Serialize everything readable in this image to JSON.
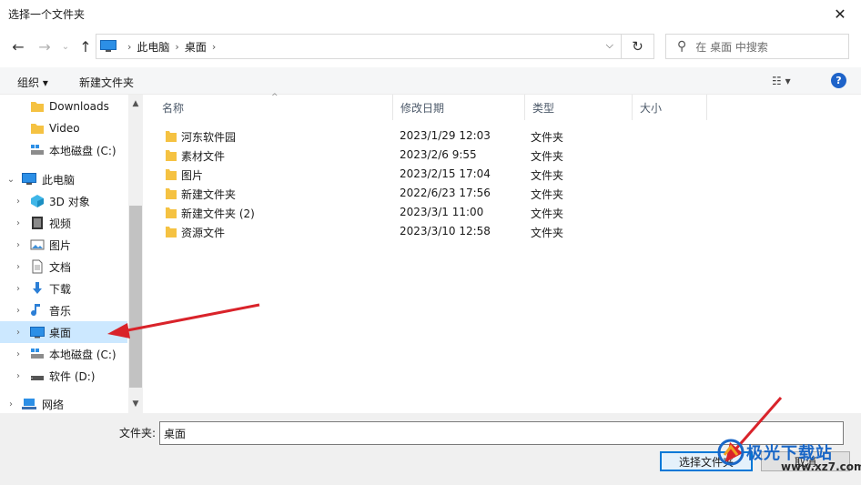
{
  "window": {
    "title": "选择一个文件夹"
  },
  "address": {
    "crumbs": [
      "此电脑",
      "桌面"
    ]
  },
  "search": {
    "placeholder": "在 桌面 中搜索"
  },
  "toolbar": {
    "organize": "组织 ▾",
    "new_folder": "新建文件夹"
  },
  "nav": {
    "items": [
      {
        "label": "Downloads",
        "icon": "folder-icon"
      },
      {
        "label": "Video",
        "icon": "folder-icon"
      },
      {
        "label": "本地磁盘 (C:)",
        "icon": "drive-icon"
      },
      {
        "label": "此电脑",
        "icon": "computer-icon"
      },
      {
        "label": "3D 对象",
        "icon": "cube-icon"
      },
      {
        "label": "视频",
        "icon": "video-icon"
      },
      {
        "label": "图片",
        "icon": "picture-icon"
      },
      {
        "label": "文档",
        "icon": "document-icon"
      },
      {
        "label": "下载",
        "icon": "download-icon"
      },
      {
        "label": "音乐",
        "icon": "music-icon"
      },
      {
        "label": "桌面",
        "icon": "desktop-icon",
        "selected": true
      },
      {
        "label": "本地磁盘 (C:)",
        "icon": "drive-icon"
      },
      {
        "label": "软件 (D:)",
        "icon": "drive-icon"
      },
      {
        "label": "网络",
        "icon": "network-icon"
      }
    ]
  },
  "columns": {
    "name": "名称",
    "date": "修改日期",
    "type": "类型",
    "size": "大小"
  },
  "files": [
    {
      "name": "河东软件园",
      "date": "2023/1/29 12:03",
      "type": "文件夹"
    },
    {
      "name": "素材文件",
      "date": "2023/2/6 9:55",
      "type": "文件夹"
    },
    {
      "name": "图片",
      "date": "2023/2/15 17:04",
      "type": "文件夹"
    },
    {
      "name": "新建文件夹",
      "date": "2022/6/23 17:56",
      "type": "文件夹"
    },
    {
      "name": "新建文件夹 (2)",
      "date": "2023/3/1 11:00",
      "type": "文件夹"
    },
    {
      "name": "资源文件",
      "date": "2023/3/10 12:58",
      "type": "文件夹"
    }
  ],
  "footer": {
    "folder_label": "文件夹:",
    "folder_value": "桌面",
    "select_button": "选择文件夹",
    "cancel_button": "取消"
  },
  "watermark": {
    "brand": "极光下载站",
    "url": "www.xz7.com"
  },
  "colors": {
    "accent": "#0078d7",
    "selection": "#cce8ff",
    "arrow": "#d9232a",
    "folder": "#f5c242"
  }
}
